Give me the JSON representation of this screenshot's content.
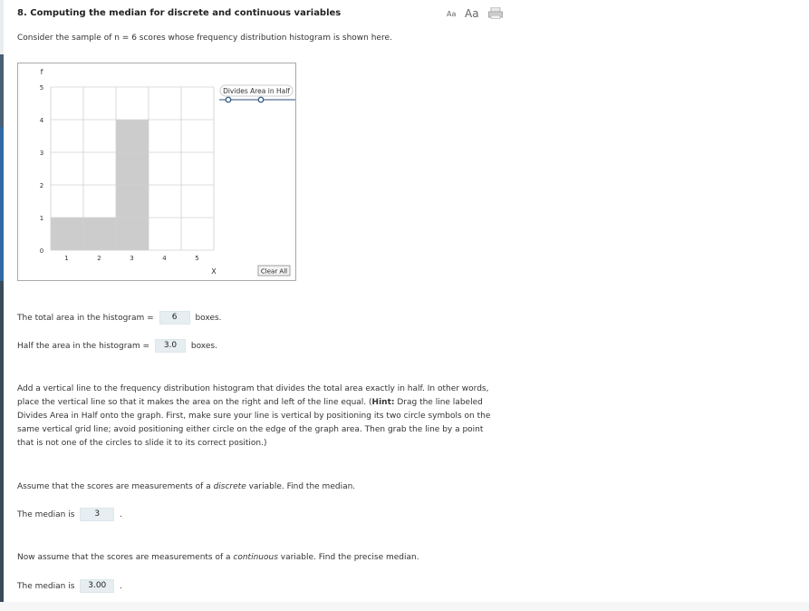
{
  "header": {
    "title": "8. Computing the median for discrete and continuous variables",
    "font_small": "Aa",
    "font_large": "Aa"
  },
  "intro": {
    "text_pre": "Consider the sample of n  = 6 scores whose frequency distribution histogram is shown here."
  },
  "graph": {
    "y_label": "f",
    "x_label": "X",
    "legend_label": "Divides Area in Half",
    "clear_label": "Clear All"
  },
  "chart_data": {
    "type": "bar",
    "categories": [
      "1",
      "2",
      "3",
      "4",
      "5"
    ],
    "values": [
      1,
      1,
      4,
      0,
      0
    ],
    "xlabel": "X",
    "ylabel": "f",
    "ylim": [
      0,
      5
    ],
    "xticks": [
      "1",
      "2",
      "3",
      "4",
      "5"
    ],
    "yticks": [
      "0",
      "1",
      "2",
      "3",
      "4",
      "5"
    ],
    "grid": true,
    "colors": {
      "bar": "#cccccc",
      "grid": "#d0d0d0",
      "line_tool": "#2a4f7a"
    }
  },
  "total_area": {
    "pre": "The total area in the histogram =",
    "value": "6",
    "post": "boxes."
  },
  "half_area": {
    "pre": "Half the area in the histogram =",
    "value": "3.0",
    "post": "boxes."
  },
  "instructions": {
    "part1": "Add a vertical line to the frequency distribution histogram that divides the total area exactly in half. In other words, place the vertical line so that it makes the area on the right and left of the line equal. (",
    "hint_label": "Hint:",
    "part2": " Drag the line labeled Divides Area in Half onto the graph. First, make sure your line is vertical by positioning its two circle symbols on the same vertical grid line; avoid positioning either circle on the edge of the graph area. Then grab the line by a point that is not one of the circles to slide it to its correct position.)"
  },
  "discrete": {
    "prompt_pre": "Assume that the scores are measurements of a ",
    "prompt_em": "discrete",
    "prompt_post": " variable. Find the median.",
    "answer_pre": "The median is",
    "answer_value": "3",
    "answer_post": "."
  },
  "continuous": {
    "prompt_pre": "Now assume that the scores are measurements of a ",
    "prompt_em": "continuous",
    "prompt_post": " variable. Find the precise median.",
    "answer_pre": "The median is",
    "answer_value": "3.00",
    "answer_post": "."
  }
}
